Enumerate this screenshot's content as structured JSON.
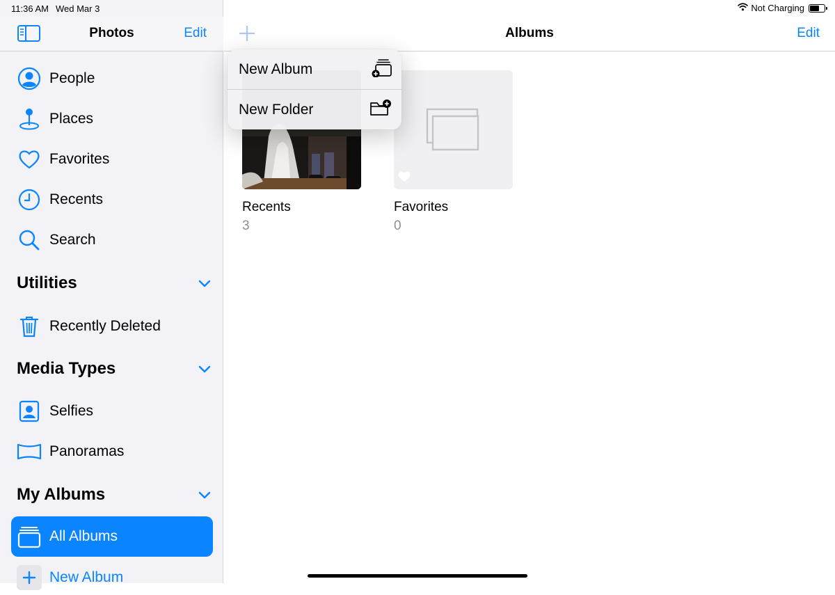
{
  "status": {
    "time": "11:36 AM",
    "date": "Wed Mar 3",
    "charging": "Not Charging"
  },
  "sidebar": {
    "title": "Photos",
    "edit_label": "Edit",
    "items": [
      {
        "label": "People",
        "icon": "person-circle-icon"
      },
      {
        "label": "Places",
        "icon": "map-pin-icon"
      },
      {
        "label": "Favorites",
        "icon": "heart-icon"
      },
      {
        "label": "Recents",
        "icon": "clock-icon"
      },
      {
        "label": "Search",
        "icon": "search-icon"
      }
    ],
    "sections": {
      "utilities": {
        "title": "Utilities",
        "items": [
          {
            "label": "Recently Deleted",
            "icon": "trash-icon"
          }
        ]
      },
      "media_types": {
        "title": "Media Types",
        "items": [
          {
            "label": "Selfies",
            "icon": "selfie-icon"
          },
          {
            "label": "Panoramas",
            "icon": "panorama-icon"
          }
        ]
      },
      "my_albums": {
        "title": "My Albums",
        "items": [
          {
            "label": "All Albums",
            "icon": "albums-stack-icon",
            "selected": true
          },
          {
            "label": "New Album",
            "icon": "plus-icon"
          }
        ]
      }
    }
  },
  "main": {
    "title": "Albums",
    "edit_label": "Edit",
    "albums": [
      {
        "name": "Recents",
        "count": "3"
      },
      {
        "name": "Favorites",
        "count": "0"
      }
    ]
  },
  "popover": {
    "items": [
      {
        "label": "New Album",
        "icon": "new-album-icon"
      },
      {
        "label": "New Folder",
        "icon": "new-folder-icon"
      }
    ]
  },
  "colors": {
    "accent": "#0a84ff",
    "sidebar_bg": "#f2f2f7",
    "secondary_text": "#8e8e93"
  }
}
